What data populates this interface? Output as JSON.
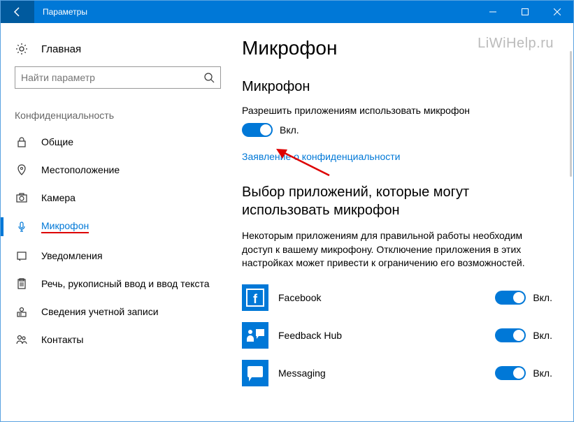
{
  "titlebar": {
    "title": "Параметры"
  },
  "watermark": "LiWiHelp.ru",
  "sidebar": {
    "home": "Главная",
    "search_placeholder": "Найти параметр",
    "category": "Конфиденциальность",
    "items": [
      {
        "label": "Общие"
      },
      {
        "label": "Местоположение"
      },
      {
        "label": "Камера"
      },
      {
        "label": "Микрофон"
      },
      {
        "label": "Уведомления"
      },
      {
        "label": "Речь, рукописный ввод и ввод текста"
      },
      {
        "label": "Сведения учетной записи"
      },
      {
        "label": "Контакты"
      }
    ]
  },
  "main": {
    "page_title": "Микрофон",
    "section1_title": "Микрофон",
    "permission_desc": "Разрешить приложениям использовать микрофон",
    "toggle_state": "Вкл.",
    "privacy_link": "Заявление о конфиденциальности",
    "section2_title": "Выбор приложений, которые могут использовать микрофон",
    "section2_desc": "Некоторым приложениям для правильной работы необходим доступ к вашему микрофону. Отключение приложения в этих настройках может привести к ограничению его возможностей.",
    "apps": [
      {
        "name": "Facebook",
        "state": "Вкл."
      },
      {
        "name": "Feedback Hub",
        "state": "Вкл."
      },
      {
        "name": "Messaging",
        "state": "Вкл."
      }
    ]
  }
}
